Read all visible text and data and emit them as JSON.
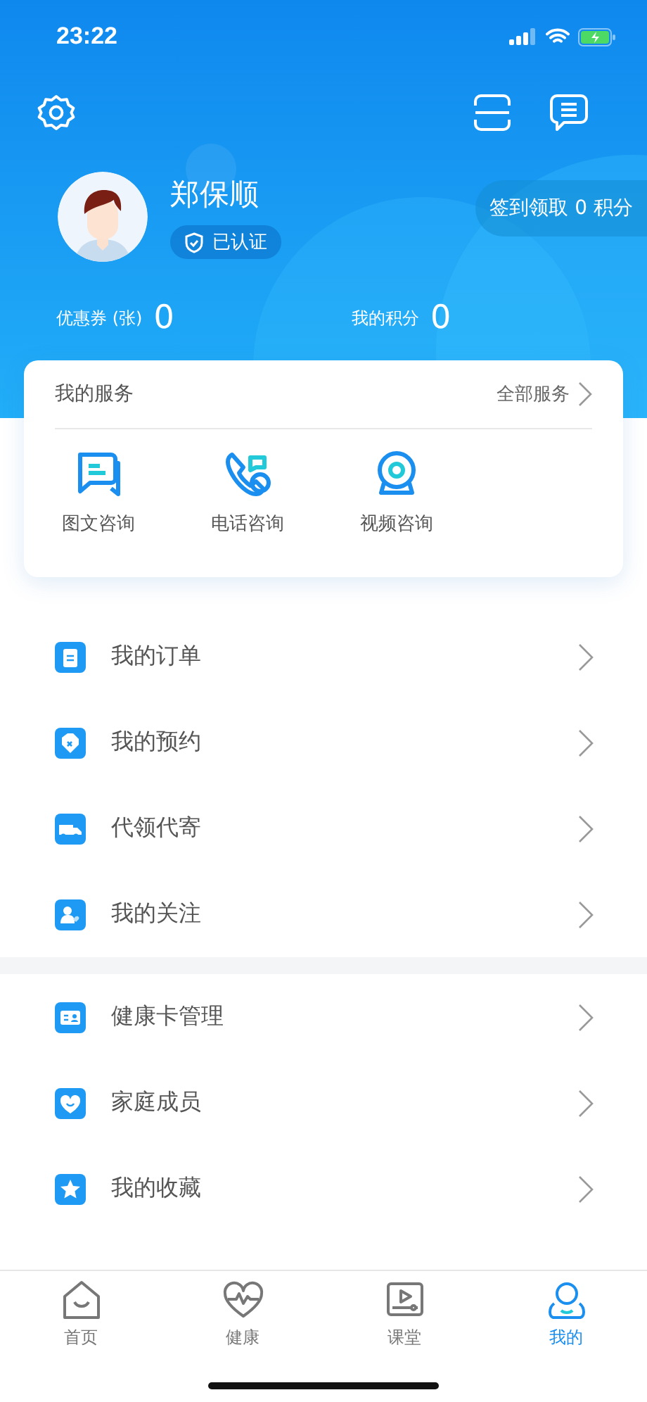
{
  "status_bar": {
    "time": "23:22"
  },
  "profile": {
    "name": "郑保顺",
    "verified_badge": "已认证",
    "checkin_button": "签到领取 0 积分"
  },
  "stats": [
    {
      "label": "优惠券 (张)",
      "value": "0"
    },
    {
      "label": "我的积分",
      "value": "0"
    }
  ],
  "services": {
    "title": "我的服务",
    "more_link": "全部服务",
    "items": [
      {
        "label": "图文咨询",
        "kind": "chat"
      },
      {
        "label": "电话咨询",
        "kind": "phone"
      },
      {
        "label": "视频咨询",
        "kind": "video"
      }
    ]
  },
  "menu_groups": [
    {
      "items": [
        {
          "label": "我的订单",
          "kind": "order"
        },
        {
          "label": "我的预约",
          "kind": "appointment"
        },
        {
          "label": "代领代寄",
          "kind": "delivery"
        },
        {
          "label": "我的关注",
          "kind": "follow"
        }
      ]
    },
    {
      "items": [
        {
          "label": "健康卡管理",
          "kind": "card"
        },
        {
          "label": "家庭成员",
          "kind": "family"
        },
        {
          "label": "我的收藏",
          "kind": "favorite"
        }
      ]
    }
  ],
  "tabs": [
    {
      "label": "首页",
      "kind": "home",
      "selected": false
    },
    {
      "label": "健康",
      "kind": "health",
      "selected": false
    },
    {
      "label": "课堂",
      "kind": "class",
      "selected": false
    },
    {
      "label": "我的",
      "kind": "mine",
      "selected": true
    }
  ]
}
